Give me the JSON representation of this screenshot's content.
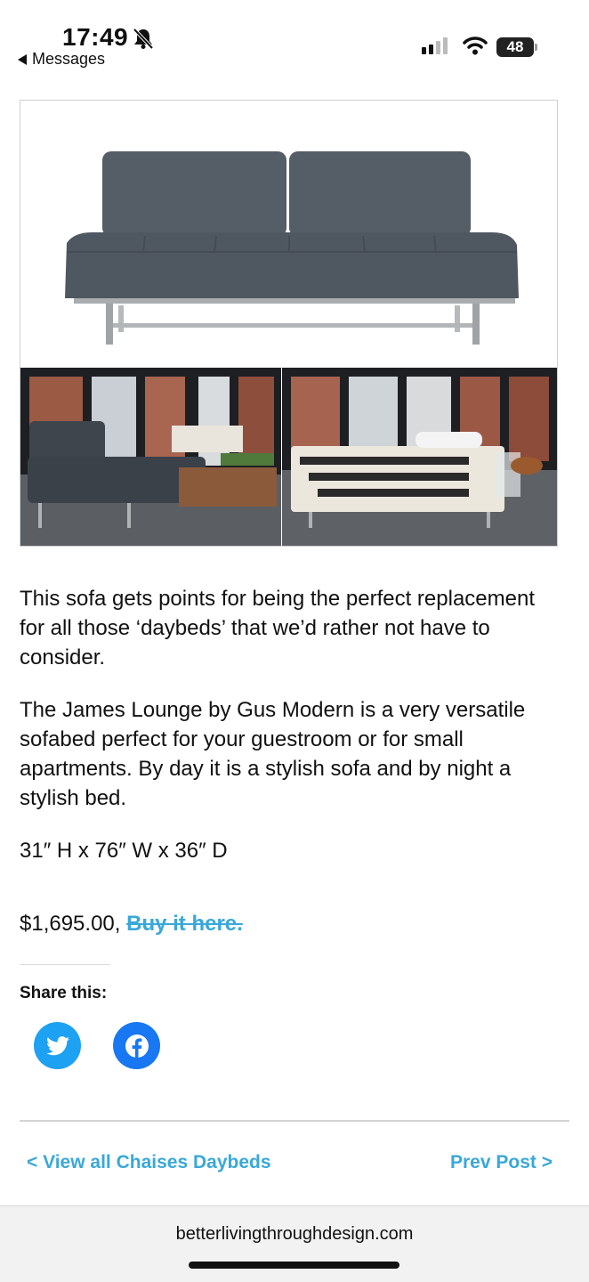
{
  "status_bar": {
    "time": "17:49",
    "back_label": "Messages",
    "battery": "48"
  },
  "product": {
    "hero_alt": "James Lounge sofa",
    "thumb_left_alt": "James Lounge as sofa in loft",
    "thumb_right_alt": "James Lounge as bed in loft"
  },
  "article": {
    "paragraph_1": "This sofa gets points for being the perfect replacement for all those ‘daybeds’ that we’d rather not have to consider.",
    "paragraph_2": "The James Lounge by Gus Modern is a very versatile sofabed perfect for your guestroom or for small apartments. By day it is a stylish sofa and by night a stylish bed.",
    "dimensions": "31″ H x 76″ W x 36″ D",
    "price": "$1,695.00,",
    "buy_link": "Buy it here."
  },
  "share": {
    "title": "Share this:"
  },
  "post_nav": {
    "prev_category": "< View all Chaises Daybeds",
    "prev_post": "Prev Post >"
  },
  "browser": {
    "url": "betterlivingthroughdesign.com"
  },
  "colors": {
    "link": "#3aa8d8",
    "twitter": "#1da1f2",
    "facebook": "#1877f2"
  }
}
